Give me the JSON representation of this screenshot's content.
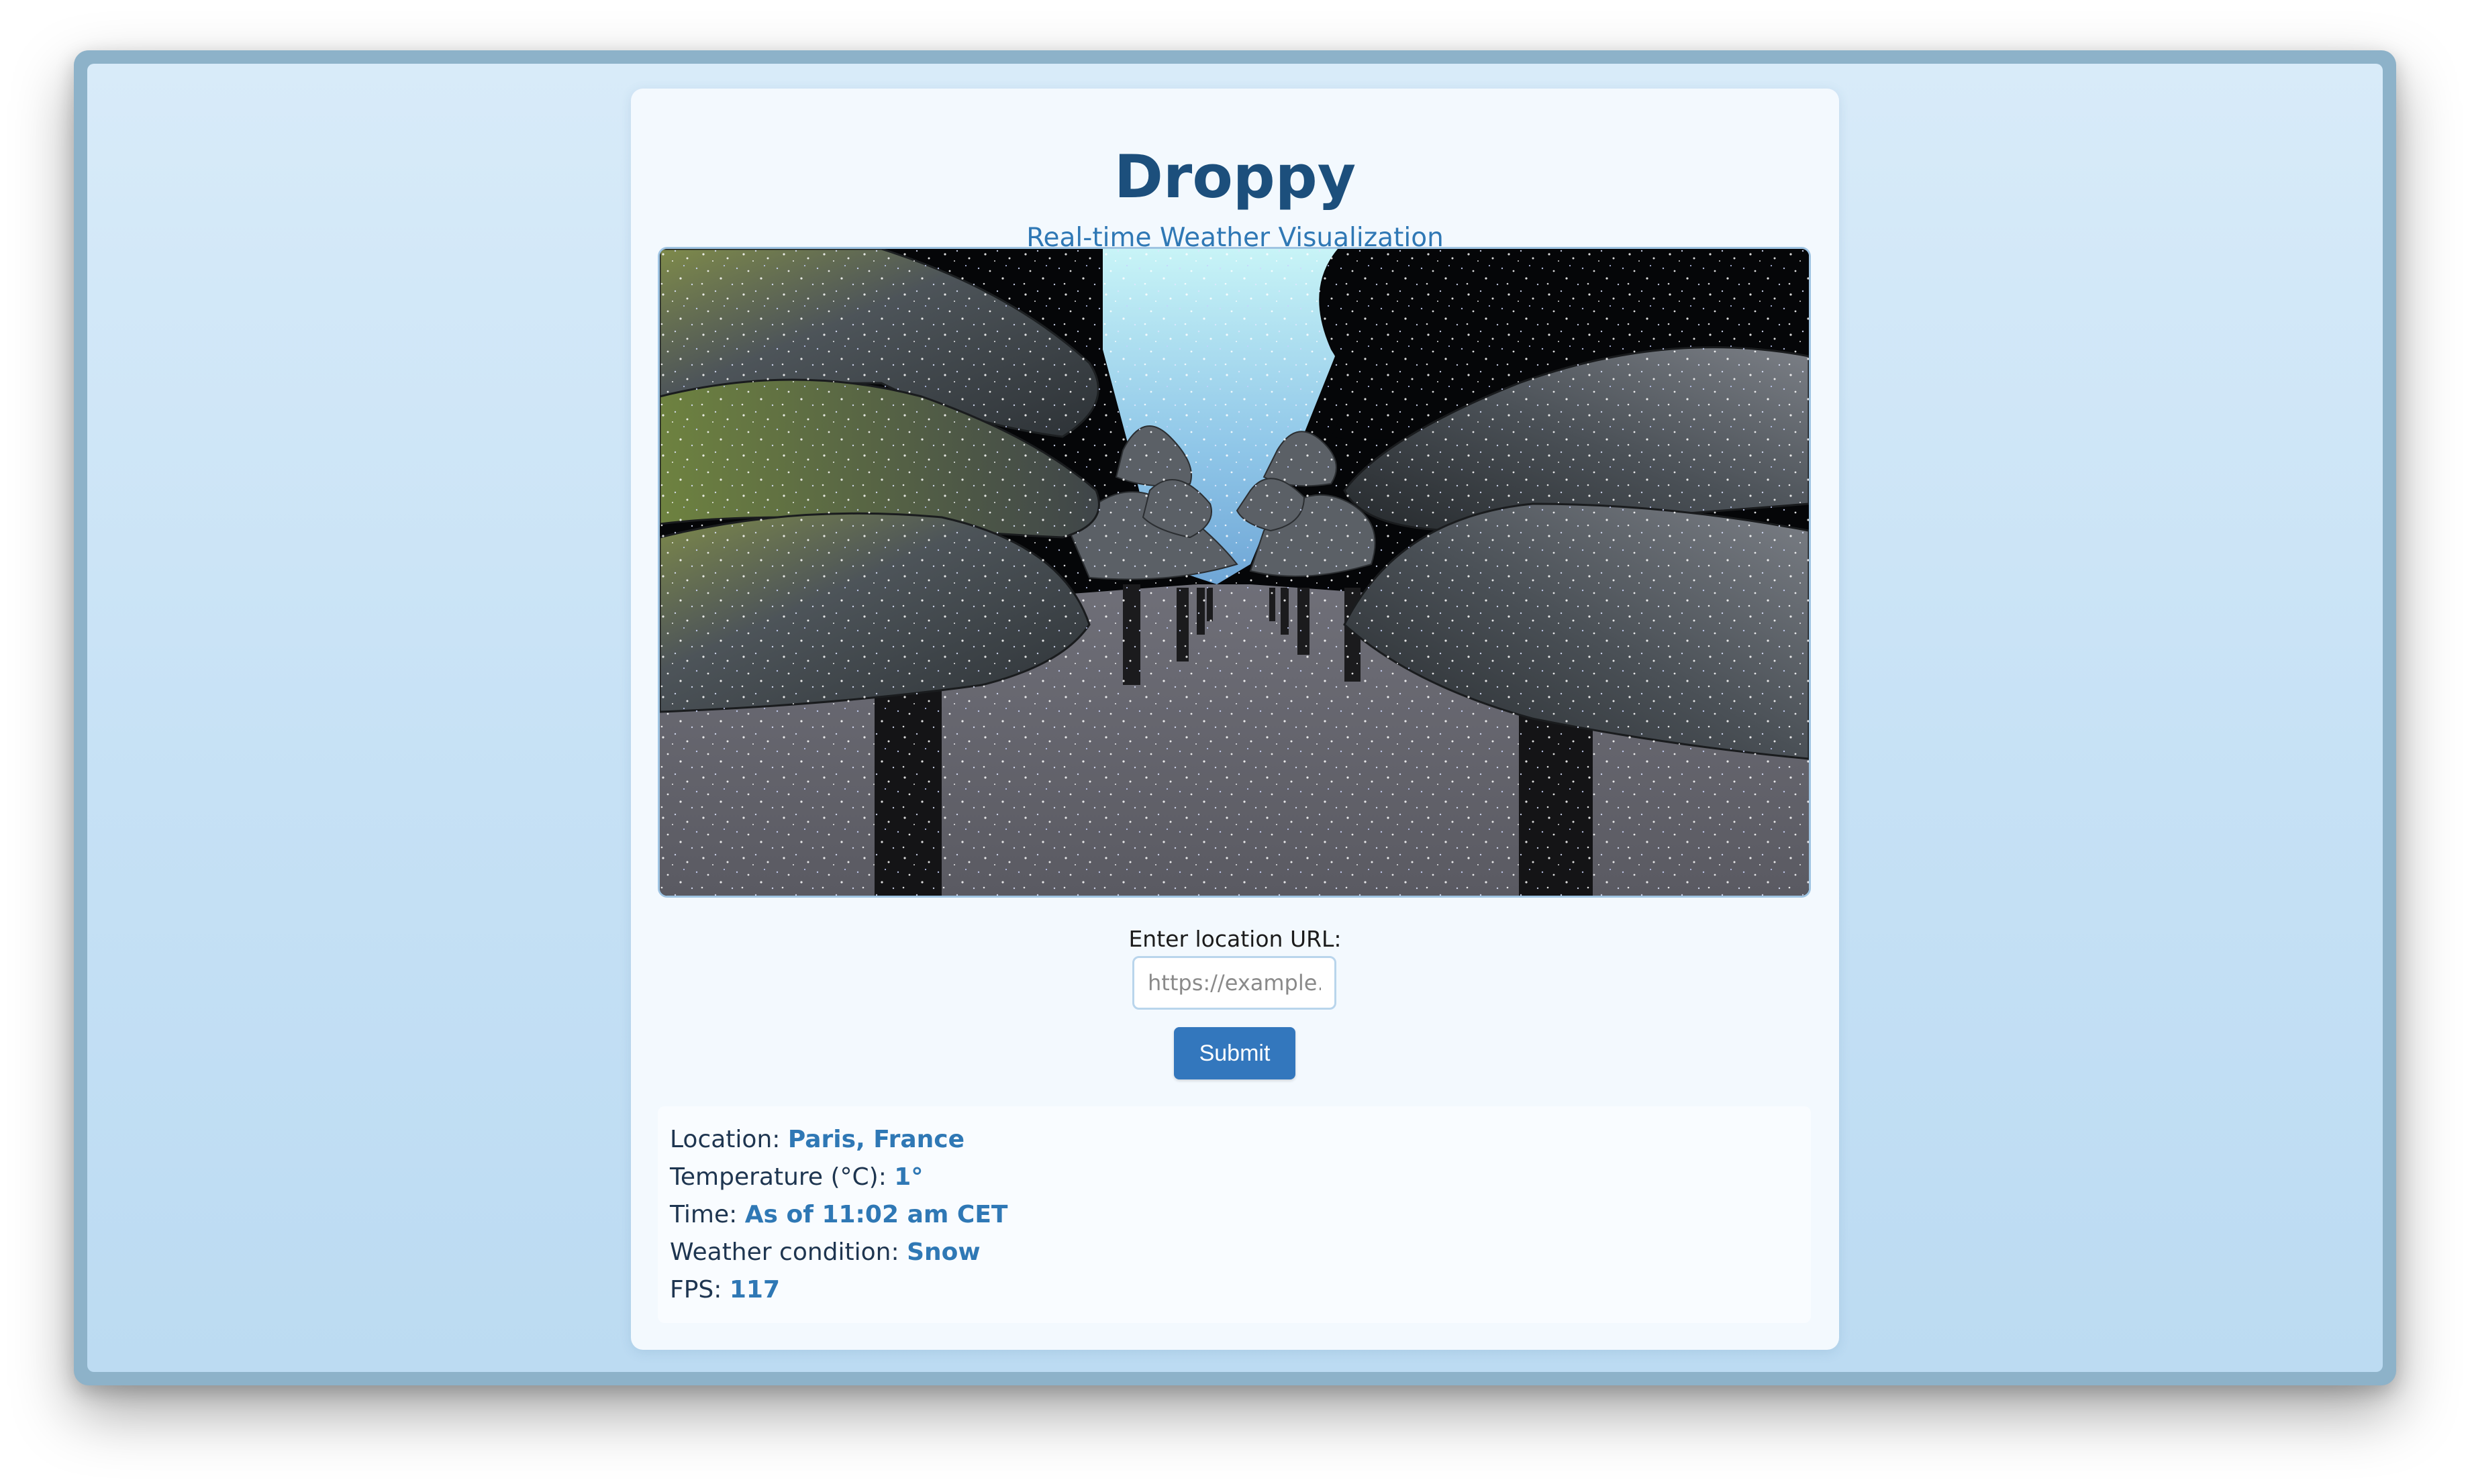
{
  "app": {
    "title": "Droppy",
    "subtitle": "Real-time Weather Visualization"
  },
  "form": {
    "label": "Enter location URL:",
    "placeholder": "https://example.co",
    "submit_label": "Submit"
  },
  "info": {
    "location_label": "Location:",
    "location_value": "Paris, France",
    "temperature_label": "Temperature (°C):",
    "temperature_value": "1°",
    "time_label": "Time:",
    "time_value": "As of 11:02 am CET",
    "condition_label": "Weather condition:",
    "condition_value": "Snow",
    "fps_label": "FPS:",
    "fps_value": "117"
  },
  "colors": {
    "title": "#1c4f7c",
    "accent": "#2f78b5",
    "button": "#3377bd",
    "background": "#c6e1f5"
  }
}
